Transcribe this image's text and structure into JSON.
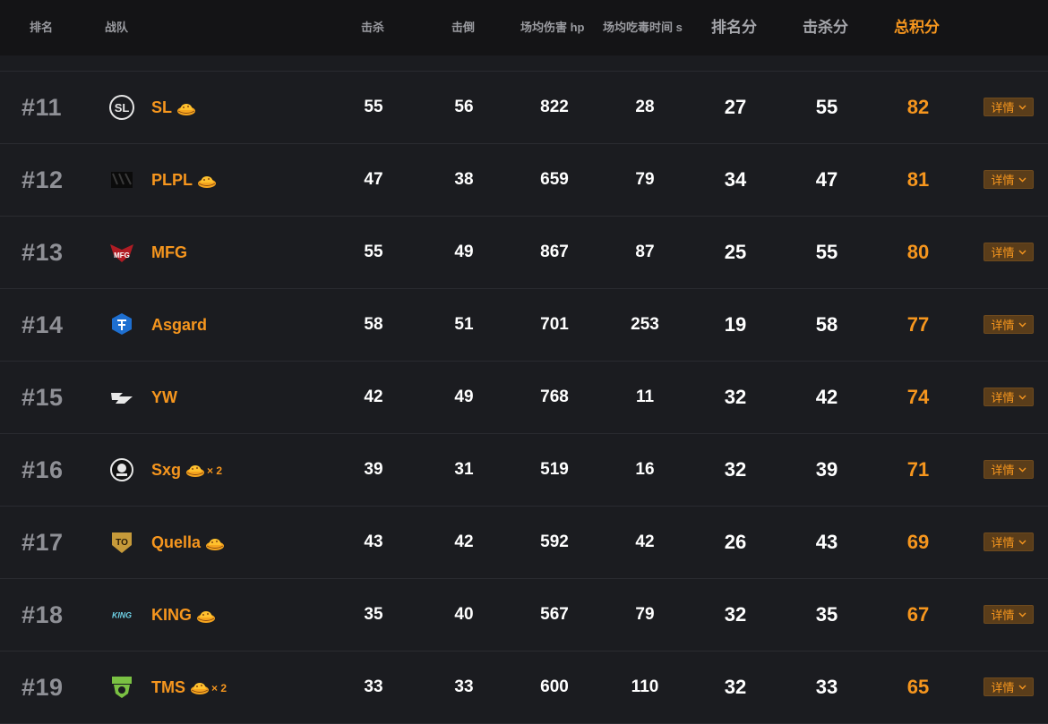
{
  "header": {
    "rank": "排名",
    "team": "战队",
    "kills": "击杀",
    "knocks": "击倒",
    "avg_damage": "场均伤害 hp",
    "avg_zone_time": "场均吃毒时间 s",
    "rank_points": "排名分",
    "kill_points": "击杀分",
    "total_points": "总积分"
  },
  "detail_label": "详情",
  "accent_color": "#f6961e",
  "rows": [
    {
      "rank": "#11",
      "team": "SL",
      "logo": "sl-logo",
      "dinner": true,
      "dinner_mult": "",
      "kills": "55",
      "knocks": "56",
      "damage": "822",
      "zone": "28",
      "rank_pts": "27",
      "kill_pts": "55",
      "total": "82"
    },
    {
      "rank": "#12",
      "team": "PLPL",
      "logo": "plpl-logo",
      "dinner": true,
      "dinner_mult": "",
      "kills": "47",
      "knocks": "38",
      "damage": "659",
      "zone": "79",
      "rank_pts": "34",
      "kill_pts": "47",
      "total": "81"
    },
    {
      "rank": "#13",
      "team": "MFG",
      "logo": "mfg-logo",
      "dinner": false,
      "dinner_mult": "",
      "kills": "55",
      "knocks": "49",
      "damage": "867",
      "zone": "87",
      "rank_pts": "25",
      "kill_pts": "55",
      "total": "80"
    },
    {
      "rank": "#14",
      "team": "Asgard",
      "logo": "asgard-logo",
      "dinner": false,
      "dinner_mult": "",
      "kills": "58",
      "knocks": "51",
      "damage": "701",
      "zone": "253",
      "rank_pts": "19",
      "kill_pts": "58",
      "total": "77"
    },
    {
      "rank": "#15",
      "team": "YW",
      "logo": "yw-logo",
      "dinner": false,
      "dinner_mult": "",
      "kills": "42",
      "knocks": "49",
      "damage": "768",
      "zone": "11",
      "rank_pts": "32",
      "kill_pts": "42",
      "total": "74"
    },
    {
      "rank": "#16",
      "team": "Sxg",
      "logo": "sxg-logo",
      "dinner": true,
      "dinner_mult": "× 2",
      "kills": "39",
      "knocks": "31",
      "damage": "519",
      "zone": "16",
      "rank_pts": "32",
      "kill_pts": "39",
      "total": "71"
    },
    {
      "rank": "#17",
      "team": "Quella",
      "logo": "quella-logo",
      "dinner": true,
      "dinner_mult": "",
      "kills": "43",
      "knocks": "42",
      "damage": "592",
      "zone": "42",
      "rank_pts": "26",
      "kill_pts": "43",
      "total": "69"
    },
    {
      "rank": "#18",
      "team": "KING",
      "logo": "king-logo",
      "dinner": true,
      "dinner_mult": "",
      "kills": "35",
      "knocks": "40",
      "damage": "567",
      "zone": "79",
      "rank_pts": "32",
      "kill_pts": "35",
      "total": "67"
    },
    {
      "rank": "#19",
      "team": "TMS",
      "logo": "tms-logo",
      "dinner": true,
      "dinner_mult": "× 2",
      "kills": "33",
      "knocks": "33",
      "damage": "600",
      "zone": "110",
      "rank_pts": "32",
      "kill_pts": "33",
      "total": "65"
    }
  ]
}
